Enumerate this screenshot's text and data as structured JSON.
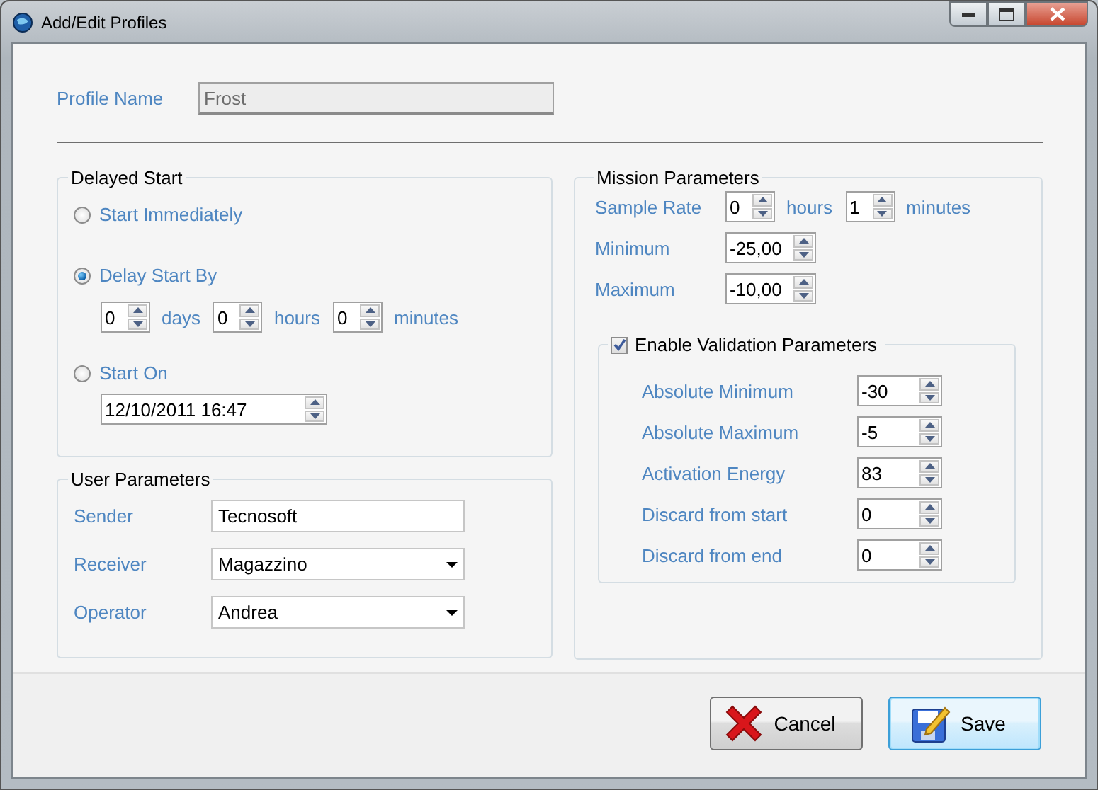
{
  "window": {
    "title": "Add/Edit Profiles"
  },
  "profile_name": {
    "label": "Profile Name",
    "value": "Frost",
    "disabled": true
  },
  "delayed_start": {
    "title": "Delayed Start",
    "options": [
      {
        "label": "Start Immediately",
        "selected": false
      },
      {
        "label": "Delay Start By",
        "selected": true
      },
      {
        "label": "Start On",
        "selected": false
      }
    ],
    "delay": [
      {
        "value": "0",
        "unit": "days"
      },
      {
        "value": "0",
        "unit": "hours"
      },
      {
        "value": "0",
        "unit": "minutes"
      }
    ],
    "start_on": "12/10/2011 16:47"
  },
  "user_parameters": {
    "title": "User Parameters",
    "fields": [
      {
        "label": "Sender",
        "value": "Tecnosoft",
        "kind": "text"
      },
      {
        "label": "Receiver",
        "value": "Magazzino",
        "kind": "dropdown"
      },
      {
        "label": "Operator",
        "value": "Andrea",
        "kind": "dropdown"
      }
    ]
  },
  "mission_parameters": {
    "title": "Mission Parameters",
    "sample_rate": {
      "label": "Sample Rate",
      "parts": [
        {
          "value": "0",
          "unit": "hours"
        },
        {
          "value": "1",
          "unit": "minutes"
        }
      ]
    },
    "ranges": [
      {
        "label": "Minimum",
        "value": "-25,00"
      },
      {
        "label": "Maximum",
        "value": "-10,00"
      }
    ],
    "validation": {
      "label": "Enable Validation Parameters",
      "checked": true,
      "fields": [
        {
          "label": "Absolute Minimum",
          "value": "-30"
        },
        {
          "label": "Absolute Maximum",
          "value": "-5"
        },
        {
          "label": "Activation Energy",
          "value": "83"
        },
        {
          "label": "Discard from start",
          "value": "0"
        },
        {
          "label": "Discard from end",
          "value": "0"
        }
      ]
    }
  },
  "buttons": [
    {
      "label": "Cancel",
      "kind": "cancel",
      "default": false
    },
    {
      "label": "Save",
      "kind": "save",
      "default": true
    }
  ]
}
